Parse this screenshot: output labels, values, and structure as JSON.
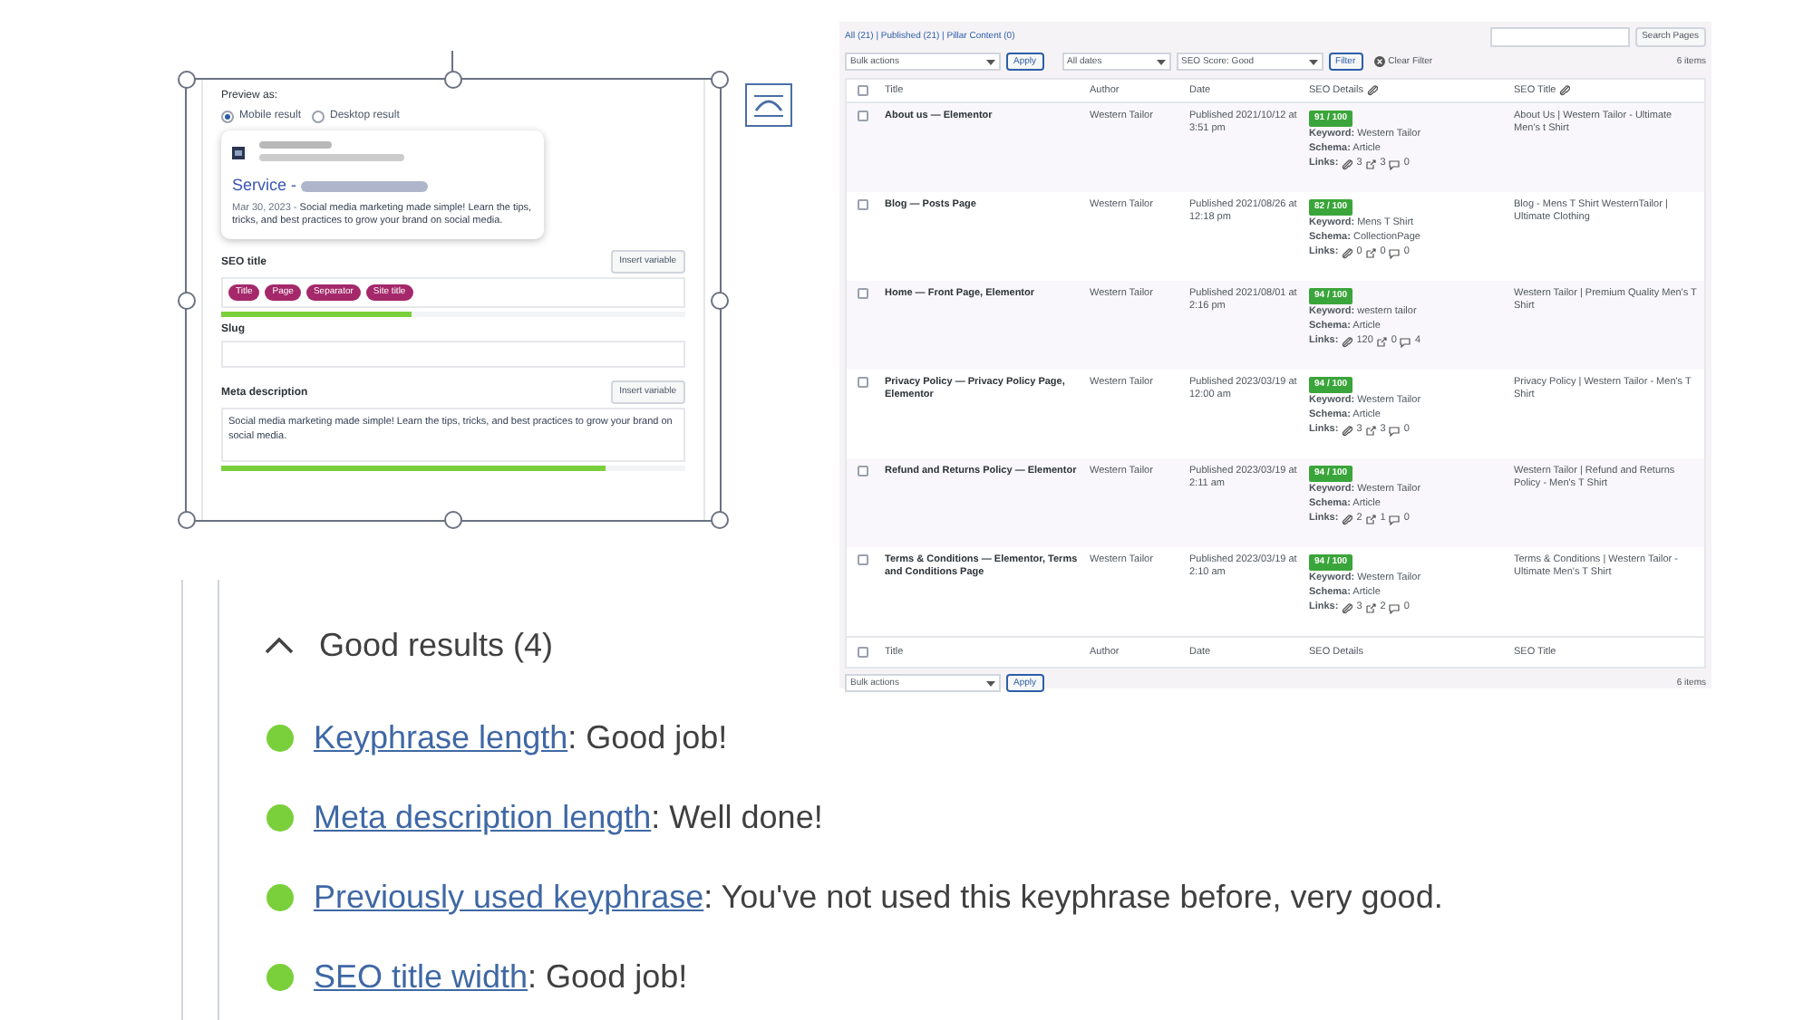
{
  "preview_card": {
    "preview_label": "Preview as:",
    "options": [
      {
        "label": "Mobile result",
        "selected": true
      },
      {
        "label": "Desktop result",
        "selected": false
      }
    ],
    "snippet": {
      "title_prefix": "Service - ",
      "date": "Mar 30, 2023",
      "separator": "-",
      "description": "Social media marketing made simple! Learn the tips, tricks, and best practices to grow your brand on social media."
    },
    "seo_title": {
      "label": "SEO title",
      "button": "Insert variable",
      "tags": [
        "Title",
        "Page",
        "Separator",
        "Site title"
      ],
      "level": 0.41
    },
    "slug": {
      "label": "Slug"
    },
    "meta_description": {
      "label": "Meta description",
      "button": "Insert variable",
      "value": "Social media marketing made simple! Learn the tips, tricks, and best practices to grow your brand on social media.",
      "level": 0.83
    }
  },
  "pages_table": {
    "views": "All (21) | Published (21) | Pillar Content (0)",
    "search_button": "Search Pages",
    "bulk_actions": "Bulk actions",
    "apply": "Apply",
    "dates": "All dates",
    "seo_score": "SEO Score: Good",
    "filter": "Filter",
    "clear_filter": "Clear Filter",
    "count": "6 items",
    "header_checked": false,
    "footer_checked": false,
    "columns": [
      {
        "label": "Title",
        "link_icon": false
      },
      {
        "label": "Author",
        "link_icon": false
      },
      {
        "label": "Date",
        "link_icon": false
      },
      {
        "label": "SEO Details",
        "link_icon": true
      },
      {
        "label": "SEO Title",
        "link_icon": true
      }
    ],
    "rows": [
      {
        "checked": false,
        "title": "About us — Elementor",
        "author": "Western Tailor",
        "status": "Published",
        "date": "2021/10/12 at 3:51 pm",
        "score": "91 / 100",
        "keyword": "**Keyword:** Western Tailor",
        "schema": "**Schema:** Article",
        "links_label": "Links:",
        "links": [
          "3",
          "3",
          "0"
        ],
        "seo_title": "About Us | Western Tailor - Ultimate Men's t Shirt"
      },
      {
        "checked": false,
        "title": "Blog — Posts Page",
        "author": "Western Tailor",
        "status": "Published",
        "date": "2021/08/26 at 12:18 pm",
        "score": "82 / 100",
        "keyword": "**Keyword:** Mens T Shirt",
        "schema": "**Schema:** CollectionPage",
        "links_label": "Links:",
        "links": [
          "0",
          "0",
          "0"
        ],
        "seo_title": "Blog - Mens T Shirt WesternTailor | Ultimate Clothing"
      },
      {
        "checked": false,
        "title": "Home — Front Page, Elementor",
        "author": "Western Tailor",
        "status": "Published",
        "date": "2021/08/01 at 2:16 pm",
        "score": "94 / 100",
        "keyword": "**Keyword:** western tailor",
        "schema": "**Schema:** Article",
        "links_label": "Links:",
        "links": [
          "120",
          "0",
          "4"
        ],
        "seo_title": "Western Tailor | Premium Quality Men's T Shirt"
      },
      {
        "checked": false,
        "title": "Privacy Policy — Privacy Policy Page, Elementor",
        "author": "Western Tailor",
        "status": "Published",
        "date": "2023/03/19 at 12:00 am",
        "score": "94 / 100",
        "keyword": "**Keyword:** Western Tailor",
        "schema": "**Schema:** Article",
        "links_label": "Links:",
        "links": [
          "3",
          "3",
          "0"
        ],
        "seo_title": "Privacy Policy | Western Tailor - Men's T Shirt"
      },
      {
        "checked": false,
        "title": "Refund and Returns Policy — Elementor",
        "author": "Western Tailor",
        "status": "Published",
        "date": "2023/03/19 at 2:11 am",
        "score": "94 / 100",
        "keyword": "**Keyword:** Western Tailor",
        "schema": "**Schema:** Article",
        "links_label": "Links:",
        "links": [
          "2",
          "1",
          "0"
        ],
        "seo_title": "Western Tailor | Refund and Returns Policy - Men's T Shirt"
      },
      {
        "checked": false,
        "title": "Terms & Conditions — Elementor, Terms and Conditions Page",
        "author": "Western Tailor",
        "status": "Published",
        "date": "2023/03/19 at 2:10 am",
        "score": "94 / 100",
        "keyword": "**Keyword:** Western Tailor",
        "schema": "**Schema:** Article",
        "links_label": "Links:",
        "links": [
          "3",
          "2",
          "0"
        ],
        "seo_title": "Terms & Conditions | Western Tailor - Ultimate Men's T Shirt"
      }
    ],
    "footer_columns": [
      "Title",
      "Author",
      "Date",
      "SEO Details",
      "SEO Title"
    ],
    "bottom_bulk_actions": "Bulk actions",
    "bottom_apply": "Apply",
    "bottom_count": "6 items"
  },
  "good_results": {
    "title": "Good results (4)",
    "expanded": true,
    "items": [
      {
        "link": "Keyphrase length",
        "text": ": Good job!"
      },
      {
        "link": "Meta description length",
        "text": ": Well done!"
      },
      {
        "link": "Previously used keyphrase",
        "text": ": You've not used this keyphrase before, very good."
      },
      {
        "link": "SEO title width",
        "text": ": Good job!"
      }
    ]
  }
}
